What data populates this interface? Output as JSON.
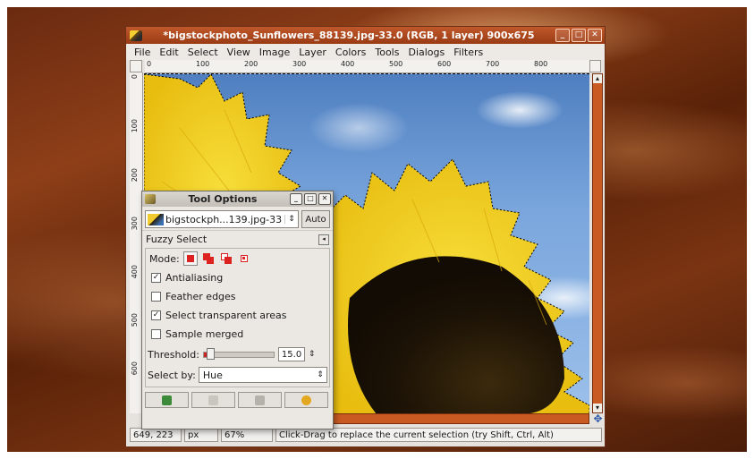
{
  "window": {
    "title": "*bigstockphoto_Sunflowers_88139.jpg-33.0 (RGB, 1 layer) 900x675",
    "controls": [
      "_",
      "□",
      "✕"
    ]
  },
  "menu": [
    "File",
    "Edit",
    "Select",
    "View",
    "Image",
    "Layer",
    "Colors",
    "Tools",
    "Dialogs",
    "Filters"
  ],
  "hruler_ticks": [
    "0",
    "100",
    "200",
    "300",
    "400",
    "500",
    "600",
    "700",
    "800"
  ],
  "vruler_ticks": [
    "0",
    "100",
    "200",
    "300",
    "400",
    "500",
    "600"
  ],
  "statusbar": {
    "coords": "649, 223",
    "unit": "px",
    "zoom": "67%",
    "message": "Click-Drag to replace the current selection (try Shift, Ctrl, Alt)"
  },
  "tool_options": {
    "title": "Tool Options",
    "controls": [
      "_",
      "□",
      "✕"
    ],
    "image_name": "bigstockph...139.jpg-33",
    "auto_label": "Auto",
    "tool_name": "Fuzzy Select",
    "mode_label": "Mode:",
    "checks": [
      {
        "label": "Antialiasing",
        "checked": true
      },
      {
        "label": "Feather edges",
        "checked": false
      },
      {
        "label": "Select transparent areas",
        "checked": true
      },
      {
        "label": "Sample merged",
        "checked": false
      }
    ],
    "threshold_label": "Threshold:",
    "threshold_value": "15.0",
    "threshold_level": 0.06,
    "select_by_label": "Select by:",
    "select_by_value": "Hue"
  },
  "colors": {
    "accent": "#c85a22",
    "sunflower": "#f2d021",
    "sky": "#6e9bd6"
  }
}
